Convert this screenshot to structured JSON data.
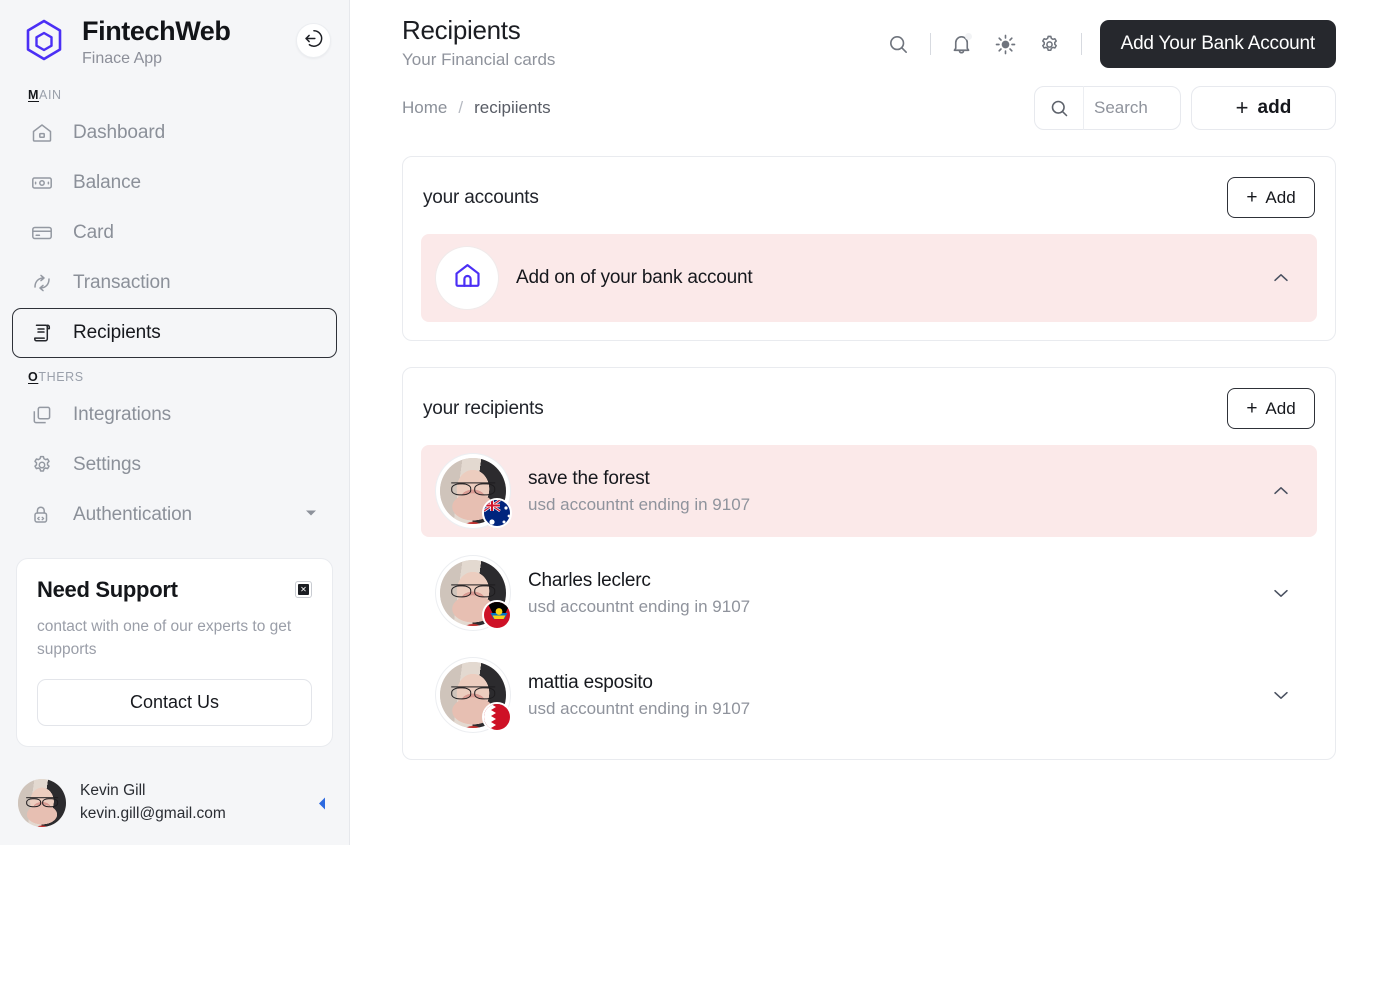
{
  "brand": {
    "title": "FintechWeb",
    "subtitle": "Finace App",
    "logo_icon": "hexagon-logo-icon",
    "logo_color": "#4b2ff5",
    "collapse_icon": "arrow-left-circle-icon"
  },
  "sidebar": {
    "groups": [
      {
        "label_first": "M",
        "label_rest": "AIN",
        "items": [
          {
            "label": "Dashboard",
            "icon": "home-icon",
            "active": false,
            "caret": false
          },
          {
            "label": "Balance",
            "icon": "wallet-icon",
            "active": false,
            "caret": false
          },
          {
            "label": "Card",
            "icon": "credit-card-icon",
            "active": false,
            "caret": false
          },
          {
            "label": "Transaction",
            "icon": "transfer-icon",
            "active": false,
            "caret": false
          },
          {
            "label": "Recipients",
            "icon": "receipt-icon",
            "active": true,
            "caret": false
          }
        ]
      },
      {
        "label_first": "O",
        "label_rest": "THERS",
        "items": [
          {
            "label": "Integrations",
            "icon": "layers-icon",
            "active": false,
            "caret": false
          },
          {
            "label": "Settings",
            "icon": "gear-icon",
            "active": false,
            "caret": false
          },
          {
            "label": "Authentication",
            "icon": "lock-code-icon",
            "active": false,
            "caret": true
          }
        ]
      }
    ],
    "support": {
      "title": "Need Support",
      "description": "contact with one of our experts to get supports",
      "button_label": "Contact Us",
      "close_icon": "close-icon"
    },
    "user": {
      "name": "Kevin Gill",
      "email": "kevin.gill@gmail.com",
      "avatar": "user-avatar",
      "caret_icon": "caret-left-icon",
      "caret_color": "#2d6ae0"
    }
  },
  "header": {
    "title": "Recipients",
    "subtitle": "Your Financial cards",
    "icons": [
      {
        "name": "search-icon"
      },
      {
        "name": "bell-icon"
      },
      {
        "name": "sun-icon"
      },
      {
        "name": "gear-icon"
      }
    ],
    "bank_button": "Add Your Bank Account",
    "bank_button_color": "#26282d"
  },
  "subbar": {
    "breadcrumb": {
      "home": "Home",
      "separator": "/",
      "current": "recipiients"
    },
    "search": {
      "value": "",
      "placeholder": "Search",
      "icon": "search-icon"
    },
    "add_button": {
      "label": "add",
      "plus": "+"
    }
  },
  "accounts_panel": {
    "title": "your accounts",
    "add_button": {
      "label": "Add",
      "plus": "+"
    },
    "rows": [
      {
        "title": "Add on of your bank account",
        "icon": "home-icon",
        "icon_color": "#4b2ff5",
        "highlight": true,
        "highlight_color": "#fbe9e9",
        "chevron": "chevron-up-icon"
      }
    ]
  },
  "recipients_panel": {
    "title": "your recipients",
    "add_button": {
      "label": "Add",
      "plus": "+"
    },
    "rows": [
      {
        "name": "save the forest",
        "account": "usd accountnt ending in 9107",
        "flag": "australia-flag",
        "highlight": true,
        "chevron": "chevron-up-icon"
      },
      {
        "name": "Charles leclerc",
        "account": "usd accountnt ending in 9107",
        "flag": "antigua-flag",
        "highlight": false,
        "chevron": "chevron-down-icon"
      },
      {
        "name": "mattia esposito",
        "account": "usd accountnt ending in 9107",
        "flag": "bahrain-flag",
        "highlight": false,
        "chevron": "chevron-down-icon"
      }
    ]
  }
}
